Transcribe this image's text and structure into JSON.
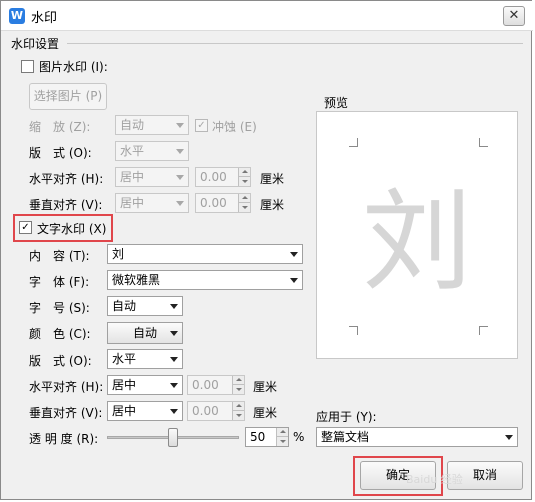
{
  "window": {
    "title": "水印",
    "app_icon_letter": "W",
    "close_glyph": "✕"
  },
  "group_title": "水印设置",
  "picture_watermark": {
    "checkbox_label": "图片水印 (I):",
    "checked": false,
    "select_picture_button": "选择图片 (P)",
    "scale_label": "缩　放 (Z):",
    "scale_value": "自动",
    "washout_label": "冲蚀 (E)",
    "washout_check": "✓",
    "layout_label": "版　式 (O):",
    "layout_value": "水平",
    "halign_label": "水平对齐 (H):",
    "halign_value": "居中",
    "halign_offset": "0.00",
    "valign_label": "垂直对齐 (V):",
    "valign_value": "居中",
    "valign_offset": "0.00",
    "unit": "厘米"
  },
  "text_watermark": {
    "checkbox_label": "文字水印 (X)",
    "checked": true,
    "check_glyph": "✓",
    "content_label": "内　容 (T):",
    "content_value": "刘",
    "font_label": "字　体 (F):",
    "font_value": "微软雅黑",
    "size_label": "字　号 (S):",
    "size_value": "自动",
    "color_label": "颜　色 (C):",
    "color_value": "自动",
    "layout_label": "版　式 (O):",
    "layout_value": "水平",
    "halign_label": "水平对齐 (H):",
    "halign_value": "居中",
    "halign_offset": "0.00",
    "valign_label": "垂直对齐 (V):",
    "valign_value": "居中",
    "valign_offset": "0.00",
    "unit": "厘米",
    "transparency_label": "透 明 度 (R):",
    "transparency_value": "50",
    "transparency_unit": "%",
    "transparency_fraction": 0.5
  },
  "preview": {
    "label": "预览",
    "sample_char": "刘"
  },
  "apply_to": {
    "label": "应用于 (Y):",
    "value": "整篇文档"
  },
  "buttons": {
    "ok": "确定",
    "cancel": "取消"
  },
  "overlay_text": "Baidu 经验",
  "colors": {
    "highlight_box": "#e0464b",
    "app_icon": "#2a7de1"
  }
}
